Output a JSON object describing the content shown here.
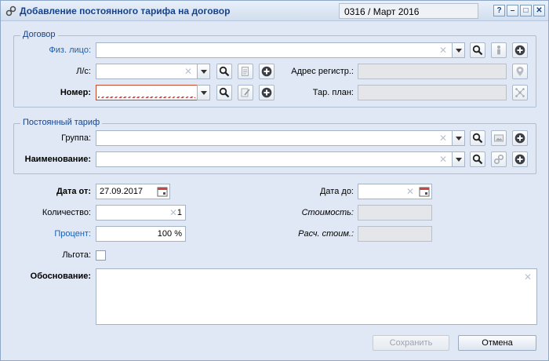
{
  "window": {
    "title": "Добавление постоянного тарифа на договор",
    "period": "0316 / Март 2016",
    "buttons": {
      "help": "?",
      "minimize": "–",
      "maximize": "□",
      "close": "✕"
    }
  },
  "contract": {
    "legend": "Договор",
    "person_label": "Физ. лицо:",
    "person_value": "",
    "account_label": "Л/с:",
    "account_value": "",
    "number_label": "Номер:",
    "number_value": "",
    "address_label": "Адрес регистр.:",
    "address_value": "",
    "plan_label": "Тар. план:",
    "plan_value": ""
  },
  "tariff": {
    "legend": "Постоянный тариф",
    "group_label": "Группа:",
    "group_value": "",
    "name_label": "Наименование:",
    "name_value": ""
  },
  "form": {
    "date_from_label": "Дата от:",
    "date_from_value": "27.09.2017",
    "date_to_label": "Дата до:",
    "date_to_value": "",
    "quantity_label": "Количество:",
    "quantity_value": "1",
    "cost_label": "Стоимость:",
    "cost_value": "",
    "percent_label": "Процент:",
    "percent_value": "100 %",
    "calc_cost_label": "Расч. стоим.:",
    "calc_cost_value": "",
    "benefit_label": "Льгота:",
    "benefit_checked": false,
    "reason_label": "Обоснование:",
    "reason_value": ""
  },
  "footer": {
    "save_label": "Сохранить",
    "cancel_label": "Отмена"
  },
  "icons": {
    "title": "link-icon",
    "search": "magnifier-icon",
    "add": "plus-circle-icon",
    "person": "person-icon",
    "doc": "document-icon",
    "location": "location-pin-icon",
    "network": "network-icon",
    "image": "image-icon",
    "link": "link-icon",
    "calendar": "calendar-icon"
  },
  "colors": {
    "accent": "#15428b",
    "link": "#1f5fb0",
    "invalid": "#e04040"
  }
}
